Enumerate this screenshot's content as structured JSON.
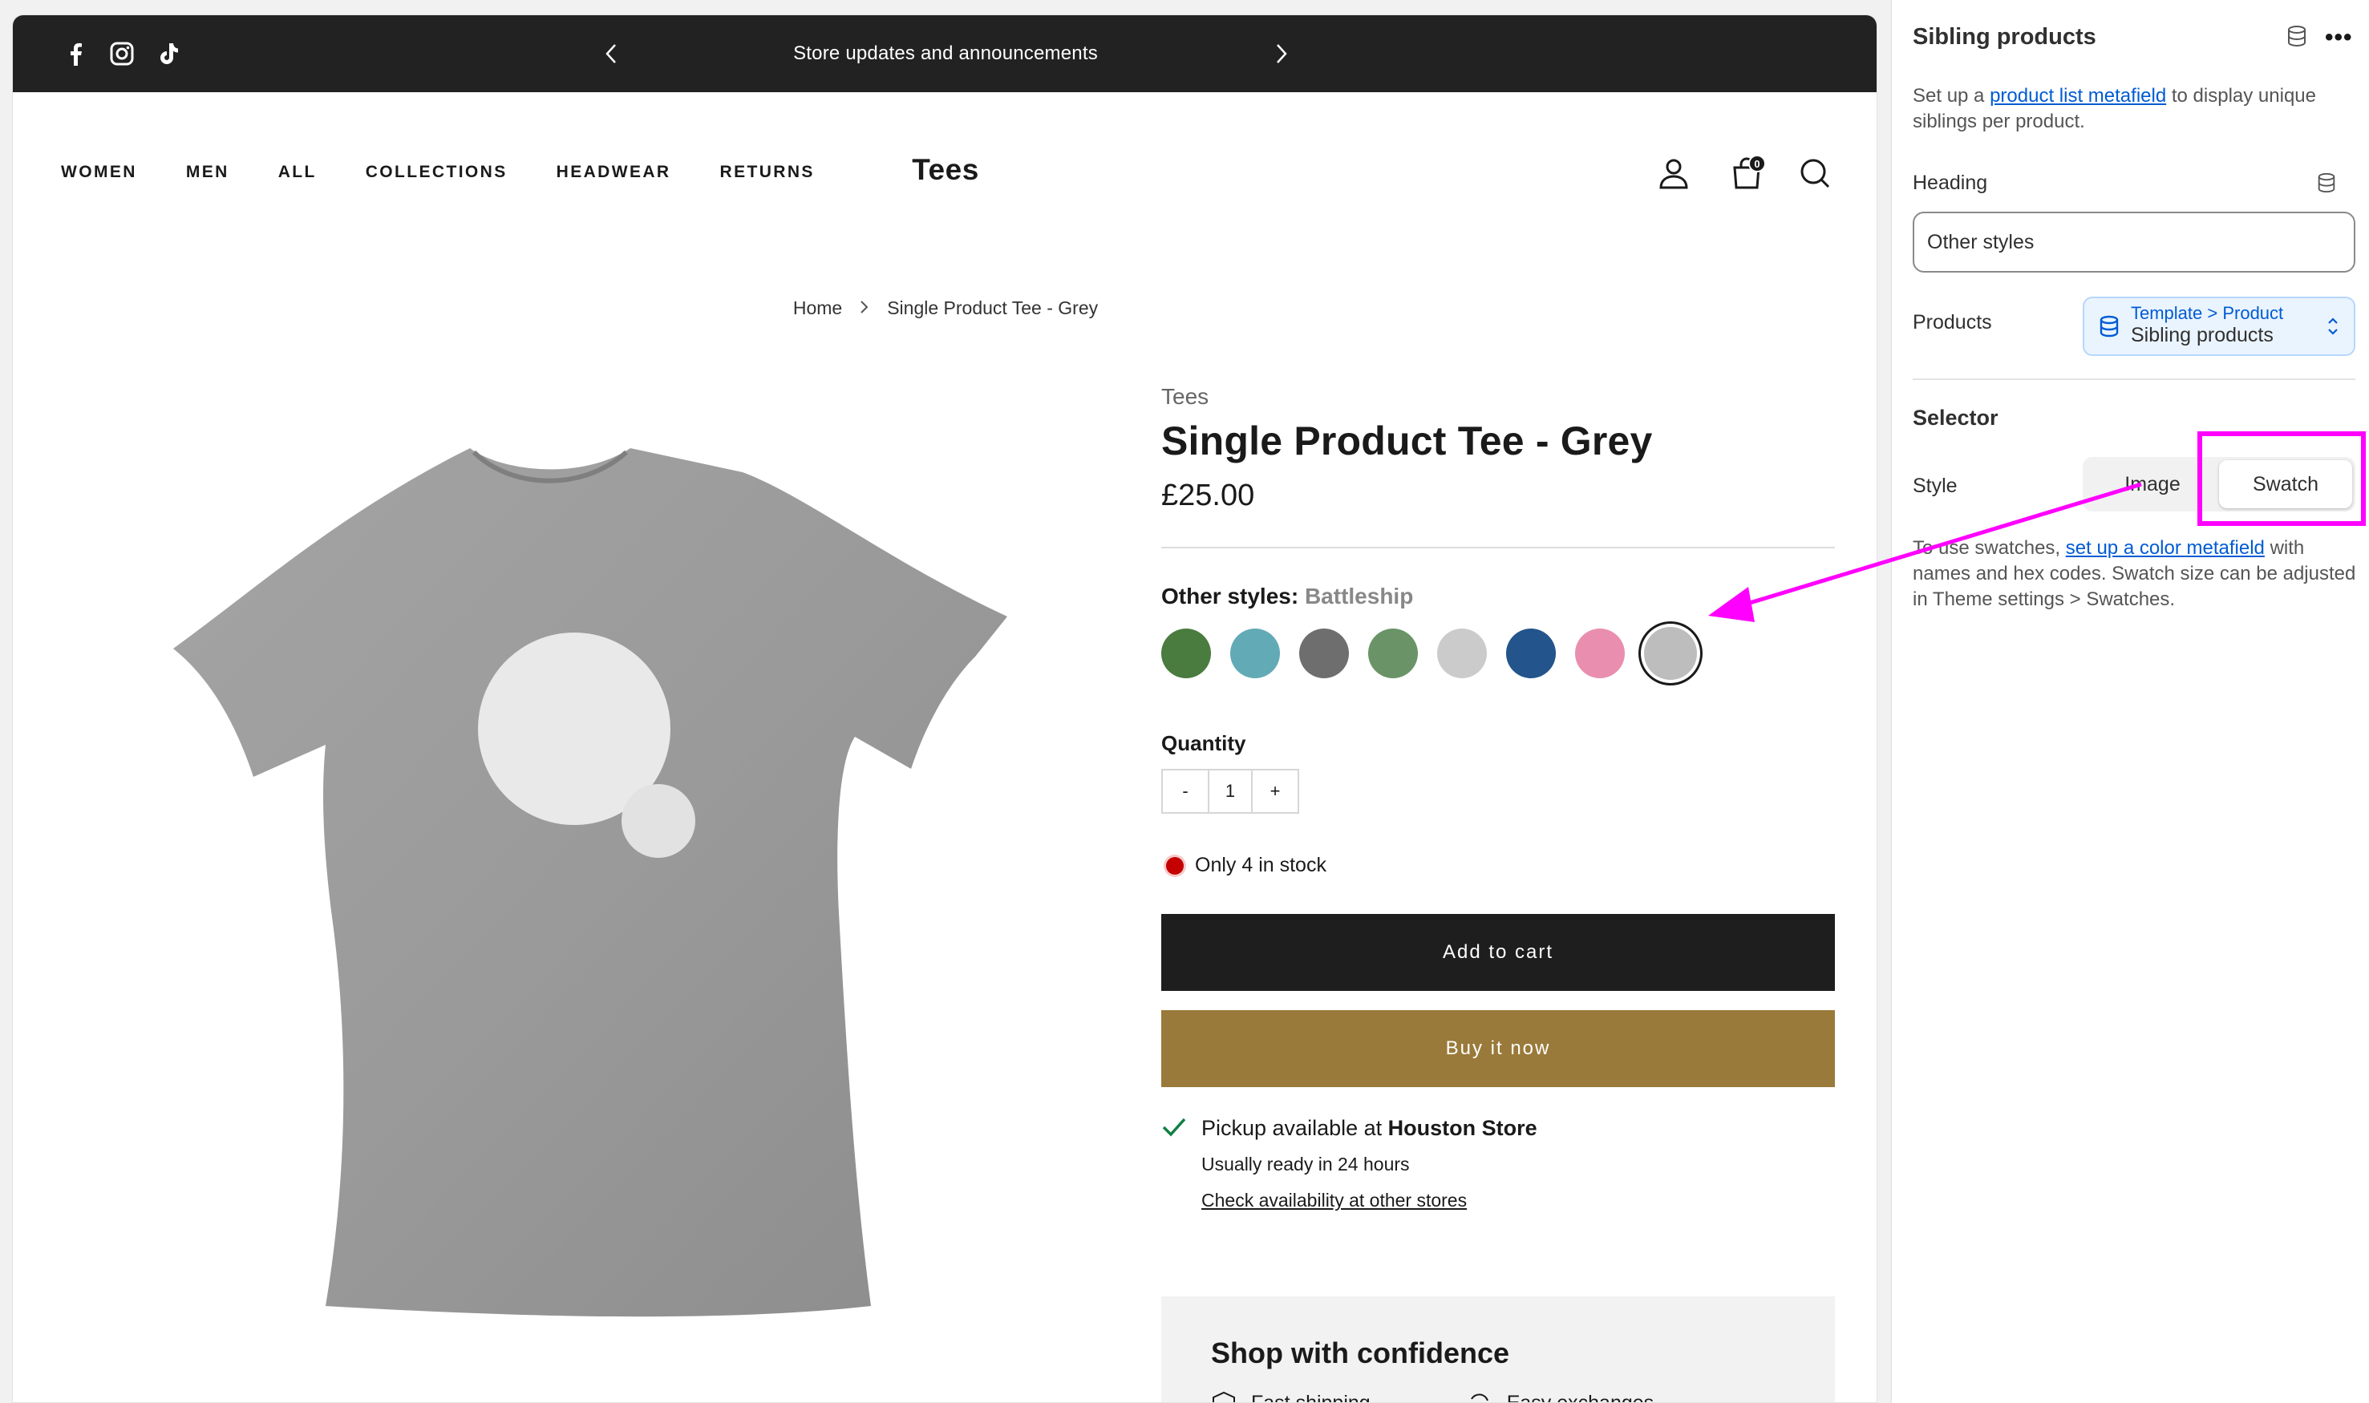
{
  "announcement": {
    "text": "Store updates and announcements"
  },
  "social_icons": [
    "facebook-icon",
    "instagram-icon",
    "tiktok-icon"
  ],
  "nav": {
    "items": [
      "WOMEN",
      "MEN",
      "ALL",
      "COLLECTIONS",
      "HEADWEAR",
      "RETURNS"
    ]
  },
  "store": {
    "logo": "Tees",
    "cart_count": "0"
  },
  "breadcrumb": {
    "home": "Home",
    "separator": ">",
    "current": "Single Product Tee - Grey"
  },
  "product": {
    "vendor": "Tees",
    "title": "Single Product Tee - Grey",
    "price": "£25.00",
    "other_styles_label": "Other styles:",
    "selected_style": "Battleship",
    "swatches": [
      {
        "color": "#4a7b3f"
      },
      {
        "color": "#62aab6"
      },
      {
        "color": "#6e6e6e"
      },
      {
        "color": "#6a9467"
      },
      {
        "color": "#cbcbcb"
      },
      {
        "color": "#23548b"
      },
      {
        "color": "#e98eae"
      },
      {
        "color": "#bdbdbd",
        "selected": true
      }
    ],
    "quantity_label": "Quantity",
    "qty_minus": "-",
    "qty_value": "1",
    "qty_plus": "+",
    "stock_text": "Only 4 in stock",
    "add_to_cart": "Add to cart",
    "buy_now": "Buy it now",
    "pickup_prefix": "Pickup available at",
    "pickup_store": "Houston Store",
    "pickup_ready": "Usually ready in 24 hours",
    "pickup_link": "Check availability at other stores",
    "confidence_title": "Shop with confidence",
    "confidence_items": [
      "Fast shipping",
      "Easy exchanges"
    ]
  },
  "panel": {
    "title": "Sibling products",
    "more": "•••",
    "intro_before": "Set up a",
    "intro_link": "product list metafield",
    "intro_after": "to display unique siblings per product.",
    "heading_label": "Heading",
    "heading_value": "Other styles",
    "products_label": "Products",
    "source_path": "Template > Product",
    "source_value": "Sibling products",
    "selector_title": "Selector",
    "style_label": "Style",
    "style_options": [
      "Image",
      "Swatch"
    ],
    "style_selected": "Swatch",
    "help_before": "To use swatches,",
    "help_link": "set up a color metafield",
    "help_after": "with names and hex codes. Swatch size can be adjusted in Theme settings > Swatches."
  },
  "colors": {
    "highlight": "#ff00ff",
    "buy_button": "#9a7a3a",
    "link": "#005bd3"
  }
}
